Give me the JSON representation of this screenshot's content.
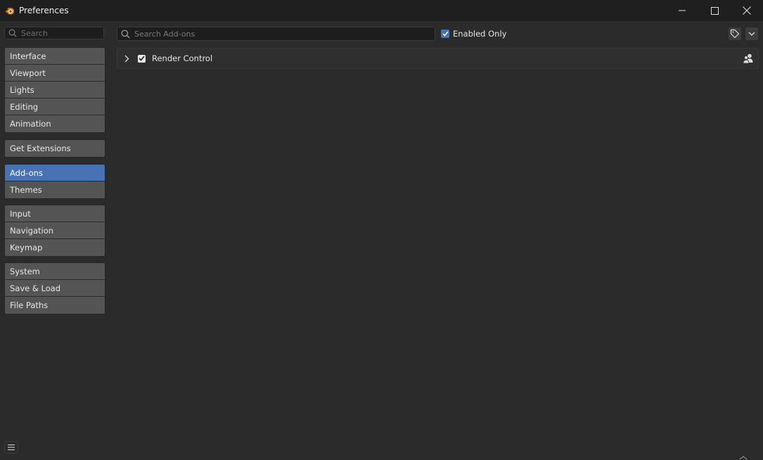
{
  "window": {
    "title": "Preferences"
  },
  "sidebar": {
    "search_placeholder": "Search",
    "groups": [
      [
        "Interface",
        "Viewport",
        "Lights",
        "Editing",
        "Animation"
      ],
      [
        "Get Extensions"
      ],
      [
        "Add-ons",
        "Themes"
      ],
      [
        "Input",
        "Navigation",
        "Keymap"
      ],
      [
        "System",
        "Save & Load",
        "File Paths"
      ]
    ],
    "active_item": "Add-ons"
  },
  "toolbar": {
    "search_placeholder": "Search Add-ons",
    "search_value": "",
    "enabled_only_label": "Enabled Only",
    "enabled_only_checked": true
  },
  "addons": [
    {
      "name": "Render Control",
      "enabled": true,
      "expanded": false
    }
  ],
  "colors": {
    "accent": "#4772b3",
    "background": "#2b2b2b",
    "titlebar": "#1f1f1f",
    "sidebar_item": "#545454"
  }
}
